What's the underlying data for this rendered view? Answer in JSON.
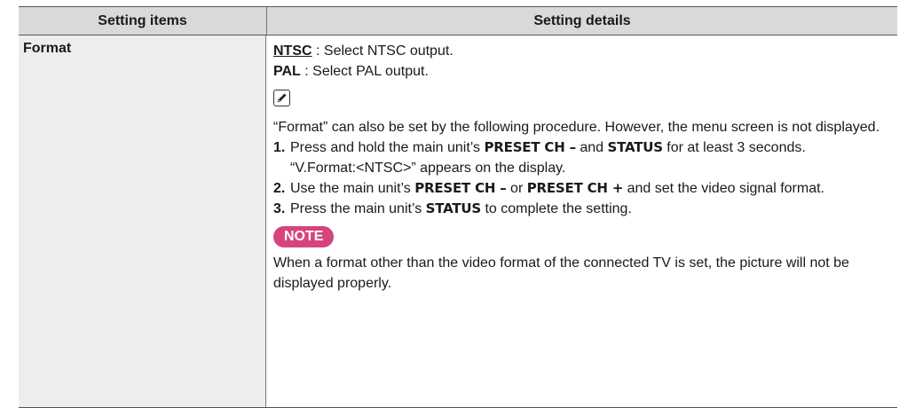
{
  "header": {
    "col1": "Setting items",
    "col2": "Setting details"
  },
  "row": {
    "item": "Format",
    "options": [
      {
        "name": "NTSC",
        "desc": " : Select NTSC output."
      },
      {
        "name": "PAL",
        "desc": " : Select PAL output."
      }
    ],
    "icon": "pencil-icon",
    "paragraph": "“Format” can also be set by the following procedure. However, the menu screen is not displayed.",
    "steps": [
      {
        "num": "1.",
        "t1": "Press and hold the main unit’s ",
        "k1": "PRESET CH –",
        "t2": " and ",
        "k2": "STATUS",
        "t3": " for at least 3 seconds.",
        "sub": "“V.Format:<NTSC>” appears on the display."
      },
      {
        "num": "2.",
        "t1": "Use the main unit’s ",
        "k1": "PRESET CH –",
        "t2": " or ",
        "k2": "PRESET CH +",
        "t3": " and set the video signal format."
      },
      {
        "num": "3.",
        "t1": "Press the main unit’s ",
        "k1": "STATUS",
        "t2": " to complete the setting."
      }
    ],
    "note_label": "NOTE",
    "note_text": "When a format other than the video format of the connected TV is set, the picture will not be displayed properly."
  },
  "colors": {
    "header_bg": "#d9d9d9",
    "left_cell_bg": "#ededed",
    "note_badge_bg": "#d6447d"
  }
}
